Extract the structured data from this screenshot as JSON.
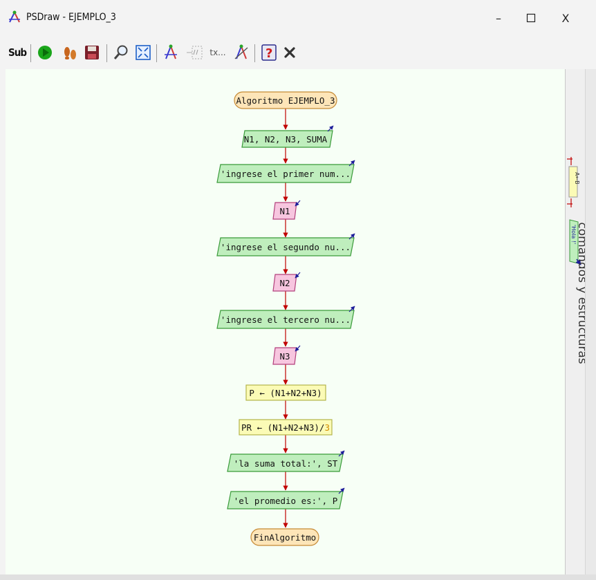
{
  "window": {
    "title": "PSDraw - EJEMPLO_3",
    "minimize_glyph": "–",
    "close_glyph": "X"
  },
  "toolbar": {
    "sub_label": "Sub",
    "text_tool_label": "tx..."
  },
  "side_panel": {
    "label": "comandos y estructuras",
    "assign_icon_label": "A←B",
    "write_icon_label": "'Hola !'"
  },
  "flowchart": {
    "start": "Algoritmo EJEMPLO_3",
    "define": "N1, N2, N3, SUMA",
    "write1": "'ingrese el primer num...",
    "read1": "N1",
    "write2": "'ingrese el segundo nu...",
    "read2": "N2",
    "write3": "'ingrese el tercero nu...",
    "read3": "N3",
    "assign1": "P ← (N1+N2+N3)",
    "assign2_prefix": "PR ← (N1+N2+N3)/",
    "assign2_suffix": "3",
    "write4": "'la suma total:', ST",
    "write5": "'el promedio es:', P",
    "end": "FinAlgoritmo"
  },
  "colors": {
    "canvas_bg": "#f7fff6",
    "io_fill": "#bfeebd",
    "io_stroke": "#3a9a3a",
    "read_fill": "#f7c6df",
    "read_stroke": "#b2407c",
    "assign_fill": "#fbfbb6",
    "assign_stroke": "#b3b34a",
    "terminal_fill": "#fde5b8",
    "terminal_stroke": "#c58a35",
    "arrow": "#c00000",
    "number_highlight": "#d18a00"
  }
}
